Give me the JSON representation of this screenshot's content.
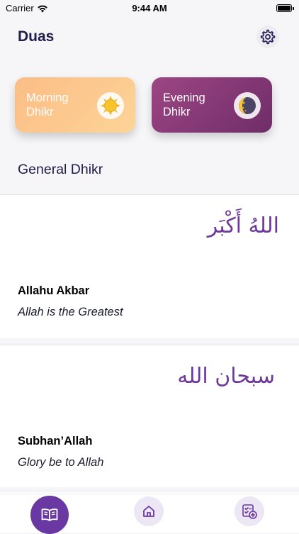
{
  "status_bar": {
    "carrier": "Carrier",
    "time": "9:44 AM"
  },
  "header": {
    "title": "Duas"
  },
  "cards": {
    "morning": {
      "label": "Morning Dhikr",
      "icon": "sun-icon"
    },
    "evening": {
      "label": "Evening Dhikr",
      "icon": "moon-icon"
    }
  },
  "section": {
    "title": "General Dhikr"
  },
  "duas": [
    {
      "arabic": "اللهُ أَكْبَر",
      "name": "Allahu Akbar",
      "meaning": "Allah is the Greatest"
    },
    {
      "arabic": "سبحان الله",
      "name": "Subhan’Allah",
      "meaning": "Glory be to Allah"
    }
  ],
  "tabs": [
    {
      "name": "duas",
      "icon": "open-book-icon",
      "active": true
    },
    {
      "name": "home",
      "icon": "home-icon",
      "active": false
    },
    {
      "name": "tracker",
      "icon": "checklist-add-icon",
      "active": false
    }
  ],
  "colors": {
    "accent": "#6a38a3",
    "arabic_text": "#6d3a9c",
    "morning_card": "#fcc98f",
    "evening_card": "#86397a",
    "title_text": "#1f1d4a"
  }
}
